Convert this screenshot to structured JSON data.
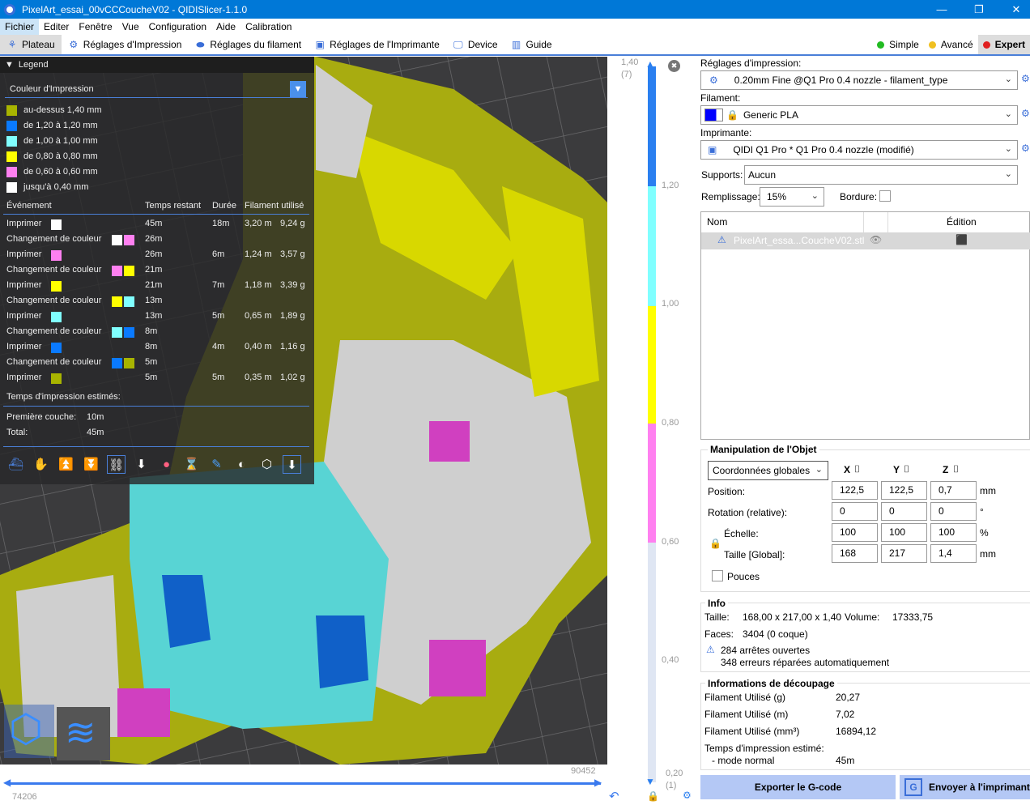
{
  "window": {
    "title": "PixelArt_essai_00vCCCoucheV02 - QIDISlicer-1.1.0",
    "minimize": "—",
    "restore": "❐",
    "close": "✕"
  },
  "menu": [
    "Fichier",
    "Editer",
    "Fenêtre",
    "Vue",
    "Configuration",
    "Aide",
    "Calibration"
  ],
  "tabs": [
    {
      "label": "Plateau",
      "icon": "plate-icon"
    },
    {
      "label": "Réglages d'Impression",
      "icon": "gear-icon"
    },
    {
      "label": "Réglages du filament",
      "icon": "spool-icon"
    },
    {
      "label": "Réglages de l'Imprimante",
      "icon": "printer-icon"
    },
    {
      "label": "Device",
      "icon": "device-icon"
    },
    {
      "label": "Guide",
      "icon": "guide-icon"
    }
  ],
  "modes": [
    {
      "label": "Simple",
      "color": "#22bb22"
    },
    {
      "label": "Avancé",
      "color": "#f0c020"
    },
    {
      "label": "Expert",
      "color": "#e02020"
    }
  ],
  "legend": {
    "title": "Legend",
    "combo": "Couleur d'Impression",
    "ranges": [
      {
        "label": "au-dessus 1,40 mm",
        "color": "#a8b400"
      },
      {
        "label": "de 1,20 à 1,20 mm",
        "color": "#0a7aff"
      },
      {
        "label": "de 1,00 à 1,00 mm",
        "color": "#80ffff"
      },
      {
        "label": "de 0,80 à 0,80 mm",
        "color": "#ffff00"
      },
      {
        "label": "de 0,60 à 0,60 mm",
        "color": "#ff80f0"
      },
      {
        "label": "jusqu'à 0,40 mm",
        "color": "#ffffff"
      }
    ],
    "headers": {
      "event": "Événement",
      "remaining": "Temps restant",
      "duration": "Durée",
      "filament": "Filament utilisé"
    },
    "events": [
      {
        "event": "Imprimer",
        "colors": [
          "#ffffff"
        ],
        "remaining": "45m",
        "duration": "18m",
        "length": "3,20 m",
        "weight": "9,24 g"
      },
      {
        "event": "Changement de couleur",
        "colors": [
          "#ffffff",
          "#ff80f0"
        ],
        "remaining": "26m",
        "duration": "",
        "length": "",
        "weight": ""
      },
      {
        "event": "Imprimer",
        "colors": [
          "#ff80f0"
        ],
        "remaining": "26m",
        "duration": "6m",
        "length": "1,24 m",
        "weight": "3,57 g"
      },
      {
        "event": "Changement de couleur",
        "colors": [
          "#ff80f0",
          "#ffff00"
        ],
        "remaining": "21m",
        "duration": "",
        "length": "",
        "weight": ""
      },
      {
        "event": "Imprimer",
        "colors": [
          "#ffff00"
        ],
        "remaining": "21m",
        "duration": "7m",
        "length": "1,18 m",
        "weight": "3,39 g"
      },
      {
        "event": "Changement de couleur",
        "colors": [
          "#ffff00",
          "#80ffff"
        ],
        "remaining": "13m",
        "duration": "",
        "length": "",
        "weight": ""
      },
      {
        "event": "Imprimer",
        "colors": [
          "#80ffff"
        ],
        "remaining": "13m",
        "duration": "5m",
        "length": "0,65 m",
        "weight": "1,89 g"
      },
      {
        "event": "Changement de couleur",
        "colors": [
          "#80ffff",
          "#0a7aff"
        ],
        "remaining": "8m",
        "duration": "",
        "length": "",
        "weight": ""
      },
      {
        "event": "Imprimer",
        "colors": [
          "#0a7aff"
        ],
        "remaining": "8m",
        "duration": "4m",
        "length": "0,40 m",
        "weight": "1,16 g"
      },
      {
        "event": "Changement de couleur",
        "colors": [
          "#0a7aff",
          "#a8b400"
        ],
        "remaining": "5m",
        "duration": "",
        "length": "",
        "weight": ""
      },
      {
        "event": "Imprimer",
        "colors": [
          "#a8b400"
        ],
        "remaining": "5m",
        "duration": "5m",
        "length": "0,35 m",
        "weight": "1,02 g"
      }
    ],
    "estimated_label": "Temps d'impression estimés:",
    "first_layer_label": "Première couche:",
    "first_layer": "10m",
    "total_label": "Total:",
    "total": "45m"
  },
  "layer_slider": {
    "top_label": "1,40",
    "top_sub": "(7)",
    "ticks": [
      "1,20",
      "1,00",
      "0,80",
      "0,60",
      "0,40"
    ],
    "bottom_label": "0,20",
    "bottom_sub": "(1)"
  },
  "move_slider": {
    "min": "74206",
    "max": "90452"
  },
  "panel": {
    "print_label": "Réglages d'impression:",
    "print_value": "0.20mm Fine @Q1 Pro 0.4 nozzle - filament_type",
    "filament_label": "Filament:",
    "filament_value": "Generic PLA",
    "filament_color": "#0000ff",
    "printer_label": "Imprimante:",
    "printer_value": "QIDI Q1 Pro * Q1 Pro 0.4 nozzle (modifié)",
    "supports_label": "Supports:",
    "supports_value": "Aucun",
    "infill_label": "Remplissage:",
    "infill_value": "15%",
    "brim_label": "Bordure:",
    "list_headers": {
      "name": "Nom",
      "edit": "Édition"
    },
    "object_name": "PixelArt_essa...CoucheV02.stl"
  },
  "manip": {
    "title": "Manipulation de l'Objet",
    "coords": "Coordonnées globales",
    "axes": [
      "X",
      "Y",
      "Z"
    ],
    "rows": [
      {
        "label": "Position:",
        "values": [
          "122,5",
          "122,5",
          "0,7"
        ],
        "unit": "mm"
      },
      {
        "label": "Rotation (relative):",
        "values": [
          "0",
          "0",
          "0"
        ],
        "unit": "°"
      },
      {
        "label": "Échelle:",
        "values": [
          "100",
          "100",
          "100"
        ],
        "unit": "%"
      },
      {
        "label": "Taille [Global]:",
        "values": [
          "168",
          "217",
          "1,4"
        ],
        "unit": "mm"
      }
    ],
    "inches": "Pouces"
  },
  "info": {
    "title": "Info",
    "size_label": "Taille:",
    "size": "168,00 x 217,00 x 1,40",
    "volume_label": "Volume:",
    "volume": "17333,75",
    "faces_label": "Faces:",
    "faces": "3404 (0 coque)",
    "warn1": "284 arrêtes ouvertes",
    "warn2": "348 erreurs réparées automatiquement"
  },
  "slice": {
    "title": "Informations de découpage",
    "rows": [
      {
        "label": "Filament Utilisé (g)",
        "value": "20,27"
      },
      {
        "label": "Filament Utilisé (m)",
        "value": "7,02"
      },
      {
        "label": "Filament Utilisé (mm³)",
        "value": "16894,12"
      }
    ],
    "time_label": "Temps d'impression estimé:",
    "mode_label": "- mode normal",
    "time": "45m"
  },
  "buttons": {
    "export": "Exporter le G-code",
    "send": "Envoyer à l'imprimante"
  }
}
